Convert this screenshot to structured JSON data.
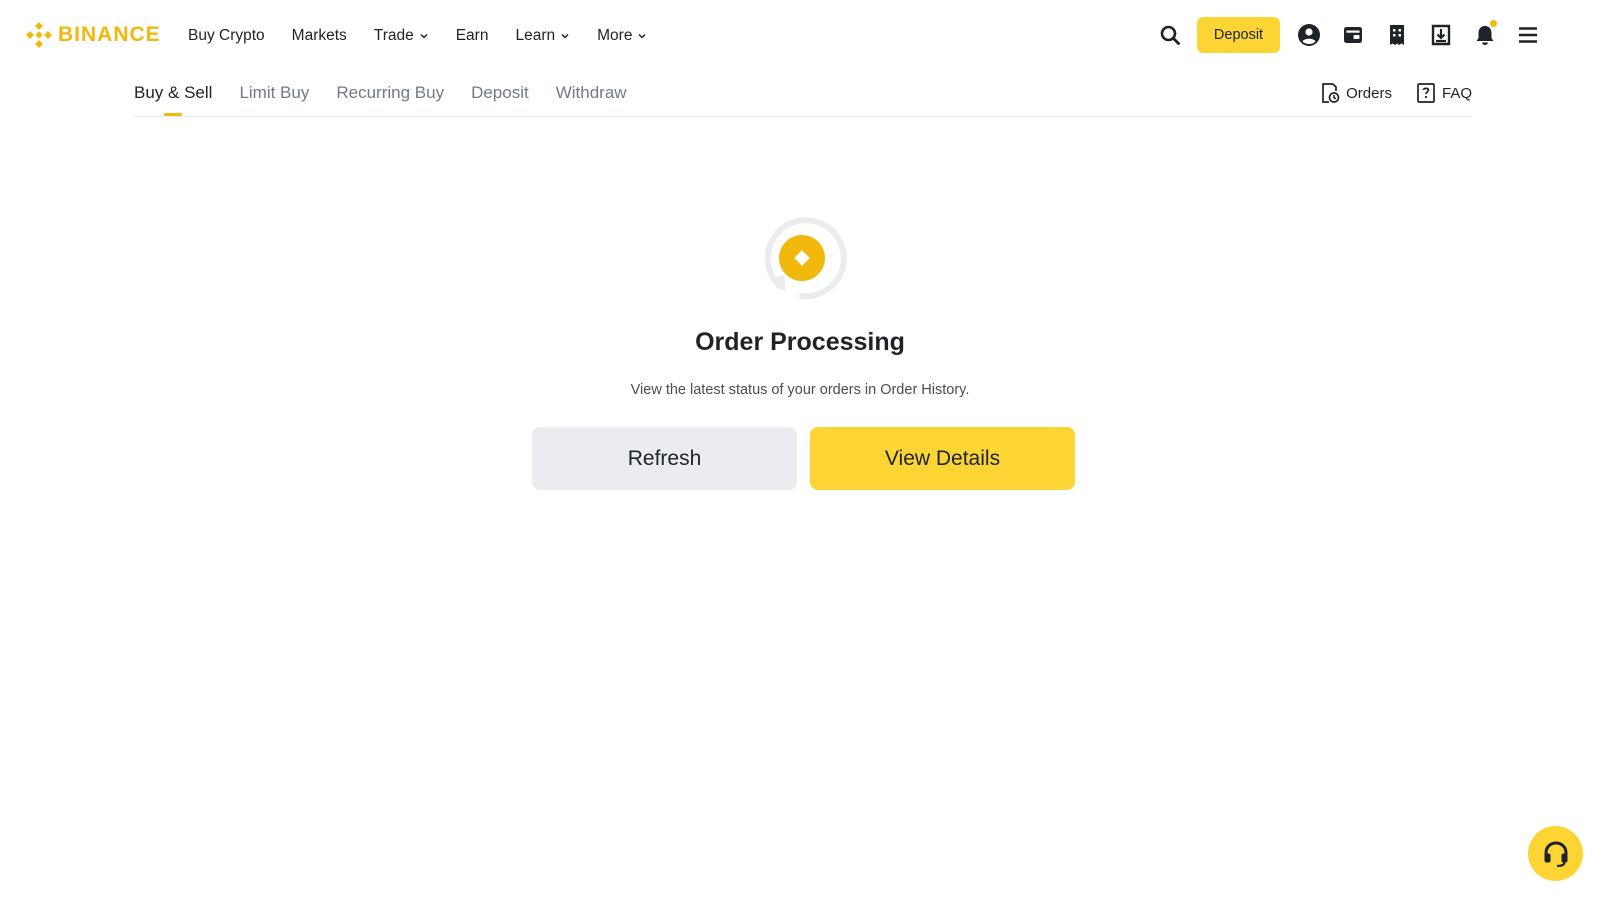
{
  "brand": {
    "name": "BINANCE",
    "color": "#f0b90b"
  },
  "nav": {
    "menu": [
      {
        "label": "Buy Crypto",
        "dropdown": false
      },
      {
        "label": "Markets",
        "dropdown": false
      },
      {
        "label": "Trade",
        "dropdown": true
      },
      {
        "label": "Earn",
        "dropdown": false
      },
      {
        "label": "Learn",
        "dropdown": true
      },
      {
        "label": "More",
        "dropdown": true
      }
    ],
    "deposit_label": "Deposit",
    "icons": [
      "search-icon",
      "user-icon",
      "wallet-icon",
      "orders-icon",
      "download-icon",
      "bell-icon",
      "hamburger-icon"
    ]
  },
  "subnav": {
    "tabs": [
      {
        "label": "Buy & Sell",
        "active": true
      },
      {
        "label": "Limit Buy",
        "active": false
      },
      {
        "label": "Recurring Buy",
        "active": false
      },
      {
        "label": "Deposit",
        "active": false
      },
      {
        "label": "Withdraw",
        "active": false
      }
    ],
    "orders_label": "Orders",
    "faq_label": "FAQ"
  },
  "status": {
    "title": "Order Processing",
    "description": "View the latest status of your orders in Order History.",
    "refresh_label": "Refresh",
    "view_details_label": "View Details"
  },
  "colors": {
    "accent": "#fcd535",
    "brand": "#f0b90b",
    "text": "#1e2329",
    "muted": "#707a8a",
    "secondary_button": "#eaecef"
  }
}
